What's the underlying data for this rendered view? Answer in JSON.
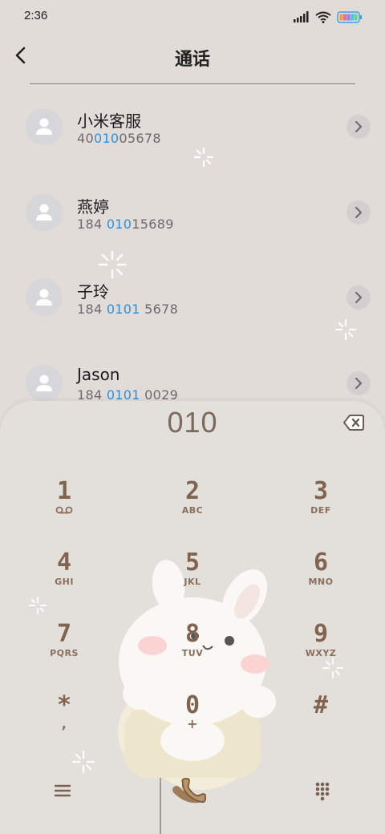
{
  "status": {
    "time": "2:36"
  },
  "header": {
    "title": "通话"
  },
  "contacts": [
    {
      "name": "小米客服",
      "number_prefix": "40",
      "number_highlight": "010",
      "number_suffix": "05678"
    },
    {
      "name": "燕婷",
      "number_prefix": "184 ",
      "number_highlight": "010",
      "number_suffix": "15689"
    },
    {
      "name": "子玲",
      "number_prefix": "184 ",
      "number_highlight": "0101",
      "number_suffix": " 5678"
    },
    {
      "name": "Jason",
      "number_prefix": "184 ",
      "number_highlight": "0101",
      "number_suffix": " 0029"
    }
  ],
  "dialpad": {
    "input": "010",
    "keys": [
      {
        "digit": "1",
        "letters": ""
      },
      {
        "digit": "2",
        "letters": "ABC"
      },
      {
        "digit": "3",
        "letters": "DEF"
      },
      {
        "digit": "4",
        "letters": "GHI"
      },
      {
        "digit": "5",
        "letters": "JKL"
      },
      {
        "digit": "6",
        "letters": "MNO"
      },
      {
        "digit": "7",
        "letters": "PQRS"
      },
      {
        "digit": "8",
        "letters": "TUV"
      },
      {
        "digit": "9",
        "letters": "WXYZ"
      },
      {
        "digit": "*",
        "letters": ","
      },
      {
        "digit": "0",
        "letters": "+"
      },
      {
        "digit": "#",
        "letters": ""
      }
    ]
  },
  "colors": {
    "background": "#e1dcd8",
    "highlight": "#2c8fdd",
    "key_text": "#80644f"
  }
}
